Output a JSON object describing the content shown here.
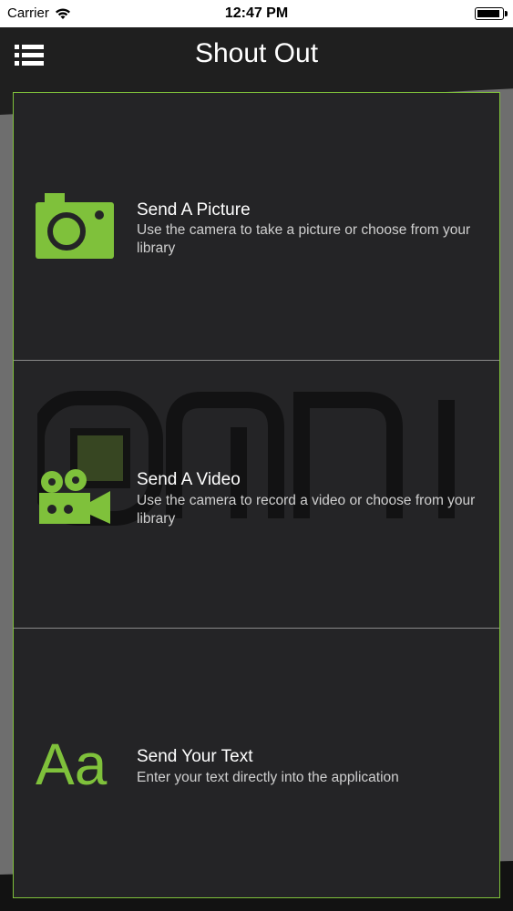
{
  "status_bar": {
    "carrier": "Carrier",
    "time": "12:47 PM",
    "icons": [
      "wifi-icon",
      "battery-icon"
    ]
  },
  "nav": {
    "title": "Shout Out",
    "menu_icon": "menu-icon"
  },
  "options": [
    {
      "icon": "camera-icon",
      "title": "Send A Picture",
      "description": "Use the camera to take a picture or choose from your library"
    },
    {
      "icon": "video-camera-icon",
      "title": "Send A Video",
      "description": "Use the camera to record a video or choose from your library"
    },
    {
      "icon": "text-icon",
      "icon_text": "Aa",
      "title": "Send Your Text",
      "description": "Enter your text directly into the application"
    }
  ],
  "colors": {
    "accent": "#7fc13b",
    "panel": "#242426",
    "divider": "#8a8a8a"
  }
}
